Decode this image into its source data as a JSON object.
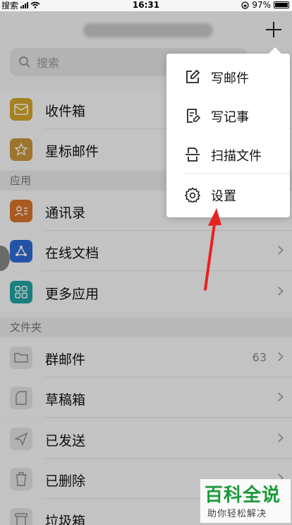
{
  "status_bar": {
    "carrier": "搜索",
    "time": "16:31",
    "battery": "97%"
  },
  "search": {
    "placeholder": "搜索"
  },
  "inbox_rows": [
    {
      "label": "收件箱",
      "icon": "inbox-icon",
      "color": "#d4a62a"
    },
    {
      "label": "星标邮件",
      "icon": "star-icon",
      "color": "#c9963a"
    }
  ],
  "apps_section": {
    "title": "应用",
    "items": [
      {
        "label": "通讯录",
        "icon": "contacts-icon",
        "color": "#d9742a"
      },
      {
        "label": "在线文档",
        "icon": "share-doc-icon",
        "color": "#2e6bd6"
      },
      {
        "label": "更多应用",
        "icon": "grid-icon",
        "color": "#22a3a3"
      }
    ]
  },
  "folders_section": {
    "title": "文件夹",
    "items": [
      {
        "label": "群邮件",
        "icon": "folder-icon",
        "count": "63"
      },
      {
        "label": "草稿箱",
        "icon": "draft-icon",
        "count": ""
      },
      {
        "label": "已发送",
        "icon": "send-icon",
        "count": ""
      },
      {
        "label": "已删除",
        "icon": "trash-icon",
        "count": ""
      },
      {
        "label": "垃圾箱",
        "icon": "spam-icon",
        "count": ""
      }
    ]
  },
  "popup_menu": [
    {
      "label": "写邮件",
      "icon": "compose-icon"
    },
    {
      "label": "写记事",
      "icon": "note-icon"
    },
    {
      "label": "扫描文件",
      "icon": "scan-icon"
    },
    {
      "label": "设置",
      "icon": "gear-icon"
    }
  ],
  "watermark": {
    "title": "百科全说",
    "subtitle": "助你轻松解决"
  },
  "colors": {
    "arrow": "#e8221f",
    "watermark": "#1a9b3a"
  }
}
